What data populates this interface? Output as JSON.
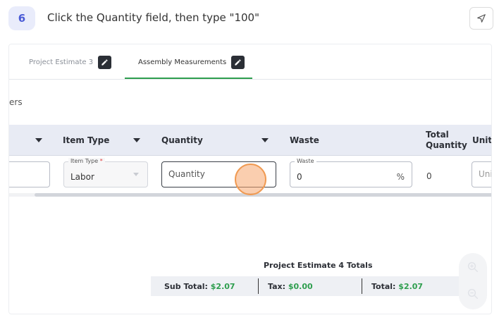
{
  "step": {
    "number": "6",
    "instruction": "Click the Quantity field, then type \"100\""
  },
  "tabs": [
    {
      "label": "Project Estimate 3"
    },
    {
      "label": "Assembly Measurements"
    }
  ],
  "cut_label": "ers",
  "table": {
    "headers": {
      "item_type": "Item Type",
      "quantity": "Quantity",
      "waste": "Waste",
      "total_quantity_line1": "Total",
      "total_quantity_line2": "Quantity",
      "unit_cut": "Unit c"
    },
    "row": {
      "item_type_label": "Item Type",
      "item_type_required": "*",
      "item_type_value": "Labor",
      "quantity_placeholder": "Quantity",
      "waste_label": "Waste",
      "waste_value": "0",
      "waste_suffix": "%",
      "total_quantity": "0",
      "unit_placeholder": "Unit"
    }
  },
  "totals": {
    "title": "Project Estimate 4 Totals",
    "sub_total_label": "Sub Total:",
    "sub_total_value": "$2.07",
    "tax_label": "Tax:",
    "tax_value": "$0.00",
    "total_label": "Total:",
    "total_value": "$2.07"
  },
  "colors": {
    "accent_green": "#2e9e4e",
    "step_badge": "#4a5bd6",
    "click_indicator": "#f09a52"
  },
  "icons": {
    "nav": "send-arrow-icon",
    "edit": "pencil-icon",
    "zoom_in": "zoom-in-icon",
    "zoom_out": "zoom-out-icon"
  }
}
